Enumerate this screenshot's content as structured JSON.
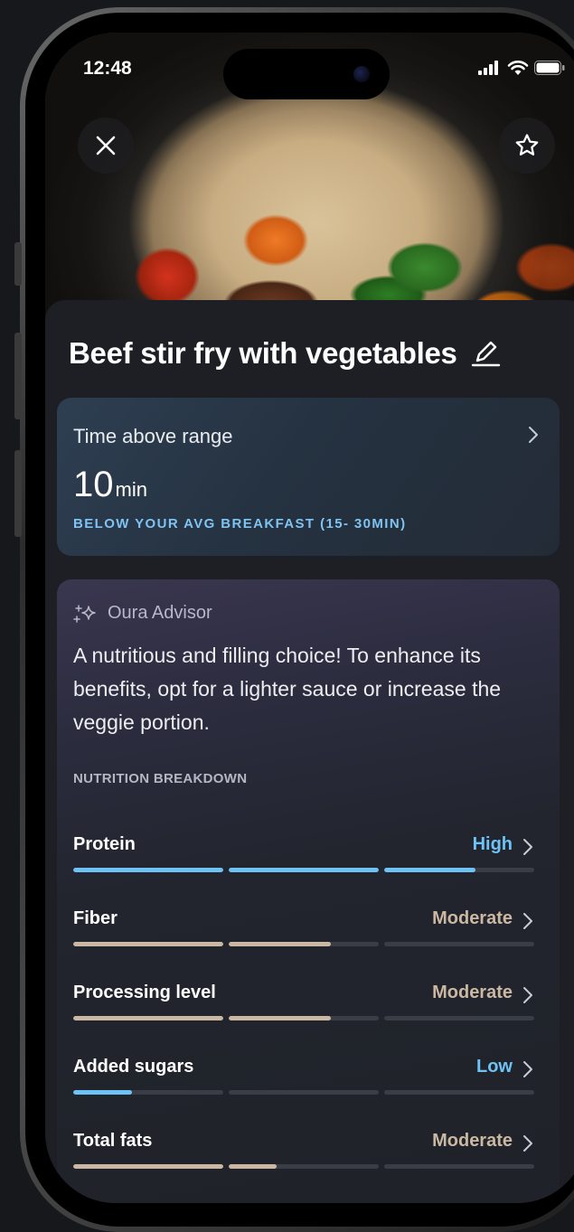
{
  "status_bar": {
    "time": "12:48"
  },
  "meal": {
    "title": "Beef stir fry with vegetables"
  },
  "time_card": {
    "label": "Time above range",
    "value": "10",
    "unit": "min",
    "note": "BELOW YOUR AVG BREAKFAST (15- 30MIN)"
  },
  "advisor": {
    "name": "Oura Advisor",
    "text": "A nutritious and filling choice! To enhance its benefits, opt for a lighter sauce or increase the veggie portion.",
    "breakdown_label": "NUTRITION BREAKDOWN"
  },
  "colors": {
    "blue": "#6ec2f5",
    "tan": "#cbb8a2",
    "track": "#3a3d46"
  },
  "nutrition": [
    {
      "name": "Protein",
      "level": "High",
      "color": "blue",
      "fill": 0.87
    },
    {
      "name": "Fiber",
      "level": "Moderate",
      "color": "tan",
      "fill": 0.56
    },
    {
      "name": "Processing level",
      "level": "Moderate",
      "color": "tan",
      "fill": 0.56
    },
    {
      "name": "Added sugars",
      "level": "Low",
      "color": "blue",
      "fill": 0.13
    },
    {
      "name": "Total fats",
      "level": "Moderate",
      "color": "tan",
      "fill": 0.44
    }
  ]
}
